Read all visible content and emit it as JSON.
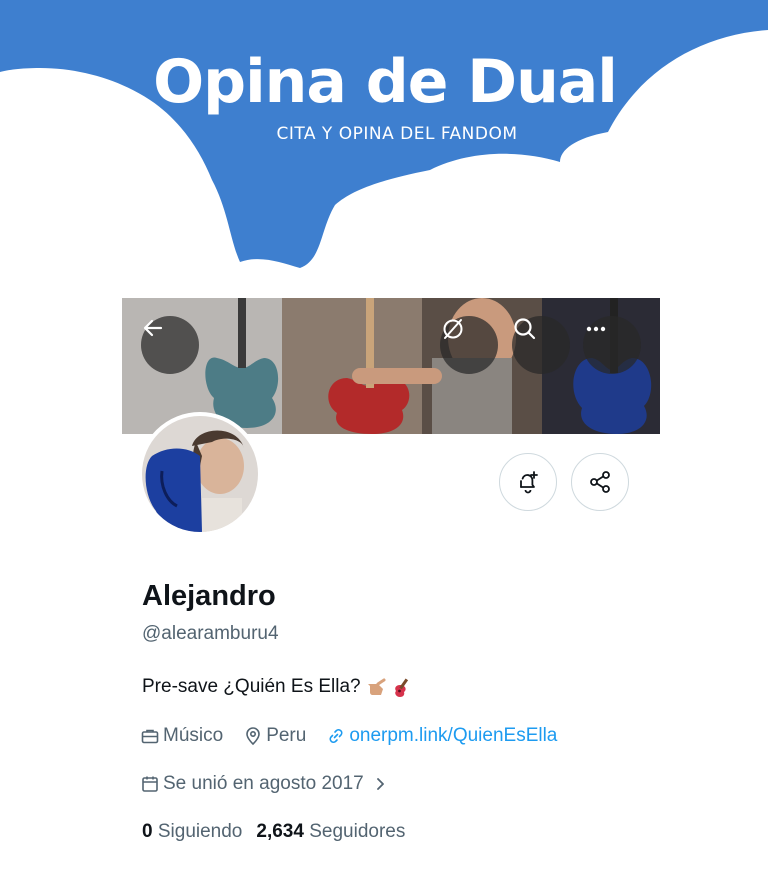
{
  "brand": {
    "title": "Opina de Dual",
    "subtitle": "CITA Y OPINA DEL FANDOM",
    "color": "#3e7fcf"
  },
  "banner": {
    "back_icon": "arrow-left-icon",
    "icons": [
      "no-circle-icon",
      "search-icon",
      "more-icon"
    ]
  },
  "profile": {
    "name": "Alejandro",
    "handle": "@alearamburu4",
    "bio": "Pre-save ¿Quién Es Ella?",
    "bio_emojis": [
      "pointing-hand-icon",
      "guitar-icon"
    ],
    "category": "Músico",
    "location": "Peru",
    "link": "onerpm.link/QuienEsElla",
    "joined": "Se unió en agosto 2017",
    "following_count": "0",
    "following_label": "Siguiendo",
    "followers_count": "2,634",
    "followers_label": "Seguidores"
  },
  "actions": {
    "notify_icon": "bell-plus-icon",
    "share_icon": "share-icon"
  },
  "colors": {
    "text": "#0f1419",
    "secondary": "#536471",
    "link": "#1d9bf0"
  }
}
